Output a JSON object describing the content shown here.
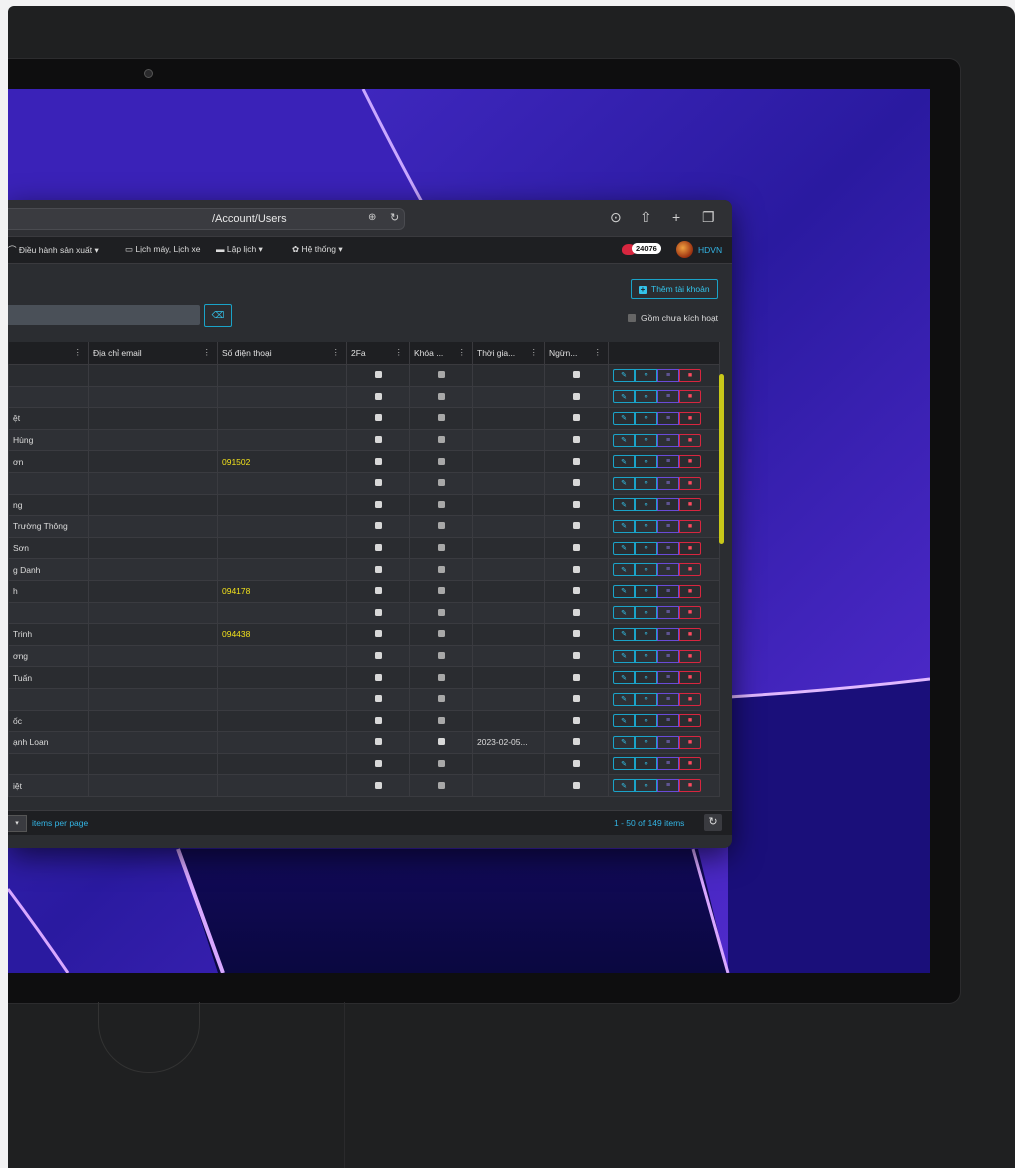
{
  "browser": {
    "url": "/Account/Users",
    "translate_icon": "translate-icon",
    "reload_icon": "reload-icon",
    "toolbar_icons": [
      "download-icon",
      "share-icon",
      "new-tab-icon",
      "tabs-icon"
    ]
  },
  "nav": {
    "items": [
      "Điều hành sản xuất ▾",
      "Lịch máy, Lịch xe",
      "Lập lịch ▾",
      "Hệ thống ▾"
    ],
    "notification_count": "24076",
    "user": "HDVN"
  },
  "toolbar": {
    "add_account": "Thêm tài khoản",
    "include_inactive": "Gồm chưa kích hoạt"
  },
  "table": {
    "headers": [
      "",
      "Địa chỉ email",
      "Số điện thoại",
      "2Fa",
      "Khóa ...",
      "Thời gia...",
      "Ngừn...",
      ""
    ],
    "rows": [
      {
        "name": "",
        "email": "",
        "phone": "",
        "fa": false,
        "lock": true,
        "time": "",
        "stop": false
      },
      {
        "name": "",
        "email": "",
        "phone": "",
        "fa": false,
        "lock": true,
        "time": "",
        "stop": false
      },
      {
        "name": "ệt",
        "email": "",
        "phone": "",
        "fa": false,
        "lock": true,
        "time": "",
        "stop": false
      },
      {
        "name": "Hùng",
        "email": "",
        "phone": "",
        "fa": false,
        "lock": true,
        "time": "",
        "stop": false
      },
      {
        "name": "ơn",
        "email": "",
        "phone": "091502",
        "fa": false,
        "lock": true,
        "time": "",
        "stop": false
      },
      {
        "name": "",
        "email": "",
        "phone": "",
        "fa": false,
        "lock": true,
        "time": "",
        "stop": false
      },
      {
        "name": "ng",
        "email": "",
        "phone": "",
        "fa": false,
        "lock": true,
        "time": "",
        "stop": false
      },
      {
        "name": "Trường Thông",
        "email": "",
        "phone": "",
        "fa": false,
        "lock": true,
        "time": "",
        "stop": false
      },
      {
        "name": "Sơn",
        "email": "",
        "phone": "",
        "fa": false,
        "lock": true,
        "time": "",
        "stop": false
      },
      {
        "name": "g Danh",
        "email": "",
        "phone": "",
        "fa": false,
        "lock": true,
        "time": "",
        "stop": false
      },
      {
        "name": "h",
        "email": "",
        "phone": "094178",
        "fa": false,
        "lock": true,
        "time": "",
        "stop": false
      },
      {
        "name": "",
        "email": "",
        "phone": "",
        "fa": false,
        "lock": true,
        "time": "",
        "stop": false
      },
      {
        "name": "Trinh",
        "email": "",
        "phone": "094438",
        "fa": false,
        "lock": true,
        "time": "",
        "stop": false
      },
      {
        "name": "ơng",
        "email": "",
        "phone": "",
        "fa": false,
        "lock": true,
        "time": "",
        "stop": false
      },
      {
        "name": "Tuấn",
        "email": "",
        "phone": "",
        "fa": false,
        "lock": true,
        "time": "",
        "stop": false
      },
      {
        "name": "",
        "email": "",
        "phone": "",
        "fa": false,
        "lock": true,
        "time": "",
        "stop": false
      },
      {
        "name": "ốc",
        "email": "",
        "phone": "",
        "fa": false,
        "lock": true,
        "time": "",
        "stop": false
      },
      {
        "name": "ạnh Loan",
        "email": "",
        "phone": "",
        "fa": false,
        "lock": false,
        "time": "2023-02-05...",
        "stop": false
      },
      {
        "name": "",
        "email": "",
        "phone": "",
        "fa": false,
        "lock": true,
        "time": "",
        "stop": false
      },
      {
        "name": "iệt",
        "email": "",
        "phone": "",
        "fa": false,
        "lock": true,
        "time": "",
        "stop": false
      }
    ],
    "action_icons": [
      "pencil-icon",
      "key-icon",
      "list-icon",
      "trash-icon"
    ]
  },
  "footer": {
    "per_page_label": "items per page",
    "pager": "1 - 50 of 149 items"
  }
}
